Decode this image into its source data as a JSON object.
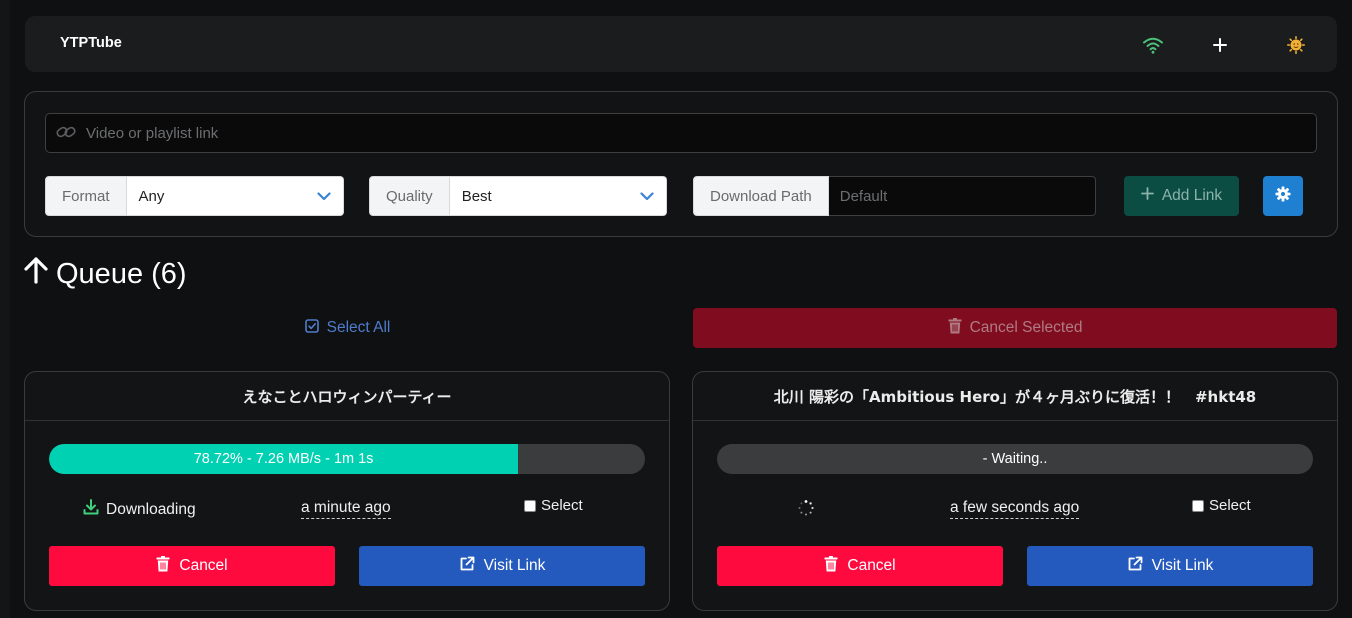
{
  "app": {
    "brand": "YTPTube"
  },
  "navbar": {
    "icons": [
      "wifi-icon",
      "plus-icon",
      "theme-icon"
    ],
    "colors": {
      "wifi": "#4cc17a",
      "theme": "#f2b134"
    }
  },
  "form": {
    "url_placeholder": "Video or playlist link",
    "format_label": "Format",
    "format_value": "Any",
    "quality_label": "Quality",
    "quality_value": "Best",
    "path_label": "Download Path",
    "path_placeholder": "Default",
    "add_label": "Add Link"
  },
  "queue": {
    "title": "Queue (6)",
    "select_all": "Select All",
    "cancel_selected": "Cancel Selected",
    "items": [
      {
        "title": "えなことハロウィンパーティー",
        "progress_text": "78.72% - 7.26 MB/s - 1m 1s",
        "progress": 78.72,
        "status": "Downloading",
        "time": "a minute ago",
        "select_label": "Select",
        "cancel_label": "Cancel",
        "visit_label": "Visit Link"
      },
      {
        "title": "北川 陽彩の「Ambitious Hero」が４ヶ月ぶりに復活！！　#hkt48",
        "progress_text": "- Waiting..",
        "progress": 0,
        "status": "",
        "time": "a few seconds ago",
        "select_label": "Select",
        "cancel_label": "Cancel",
        "visit_label": "Visit Link"
      }
    ]
  },
  "colors": {
    "accent_teal": "#00d1b2",
    "danger": "#ff0a3f",
    "link_blue": "#2459bd",
    "gear_blue": "#1f7fd1"
  }
}
